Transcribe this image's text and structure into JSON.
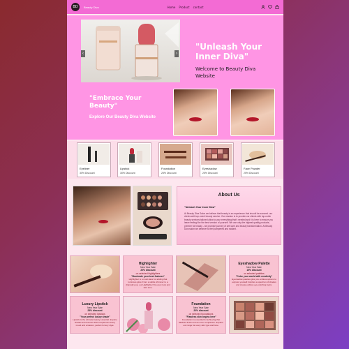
{
  "nav": {
    "logo_text": "BD",
    "brand": "Beauty Diva",
    "links": [
      "Home",
      "Product",
      "contact"
    ],
    "icons": [
      "user-icon",
      "heart-icon",
      "bag-icon"
    ]
  },
  "hero": {
    "title": "\"Unleash Your Inner Diva\"",
    "subtitle": "Welcome to Beauty Diva Website",
    "prev_arrow": "‹",
    "next_arrow": "›"
  },
  "band": {
    "title": "\"Embrace Your Beauty\"",
    "subtitle": "Explore Our Beauty Diva Website"
  },
  "products": [
    {
      "name": "Eyeliner",
      "discount": "30% Discount"
    },
    {
      "name": "Lipstick",
      "discount": "30% Discount"
    },
    {
      "name": "Foundation",
      "discount": "25% Discount"
    },
    {
      "name": "Eyeshadow",
      "discount": "25% Discount"
    },
    {
      "name": "Face Powder",
      "discount": "25% Discount"
    }
  ],
  "about": {
    "title": "About Us",
    "quote": "\"Unleash Your Inner Diva\"",
    "text": "At Beauty Diva Salon we believe that beauty is an experience that should be savored. our clients with top-notch beauty service. Our mission is to provide our clients with top-notch beauty services tailored allow to your everything that's needed and it is here to ensure you leave feeling like the best version of yourself. We use only the highest quality products, premier for beauty - we promise journey of self care and beauty transformation. At Beauty Diva salon we deserve to feel pampered and radiant."
  },
  "offers": {
    "highlighter": {
      "title": "Highlighter",
      "line1": "New Year Sale",
      "line2": "20% discount",
      "line3": "on selected highlighters",
      "tagline": "\"Illuminate your best features\"",
      "body": "Highlighter is a must-have for adding that luminous glow. From a subtle shimmer to a dramatic pop, our Highlighter fits every look and skin tone."
    },
    "eyeshadow": {
      "title": "Eyeshadow Palette",
      "line1": "New Year Sale",
      "line2": "15% discount",
      "line3": "on selected palettes",
      "tagline": "\"Color your world with creativity\"",
      "body": "Eyeshadow palettes give you endless options to express yourself. Explore a spectrum of shades and create endless eye-catching looks."
    },
    "lipstick": {
      "title": "Luxury Lipstick",
      "line1": "New Year Sale",
      "line2": "25% discount",
      "line3": "on selected lipsticks",
      "tagline": "\"Your perfect luxury shade\"",
      "body": "Lipstick is the ultimate beauty essential. Explore shades and textures that complement every mood and occasion, perfect for any style."
    },
    "foundation": {
      "title": "Foundation",
      "line1": "New Year Sale",
      "line2": "20% discount",
      "line3": "on selected foundations",
      "tagline": "\"Flawless skin begins here\"",
      "body": "Foundation is essential for achieving that flawless finish and an even complexion. Explore our range for every skin type and tone."
    }
  }
}
